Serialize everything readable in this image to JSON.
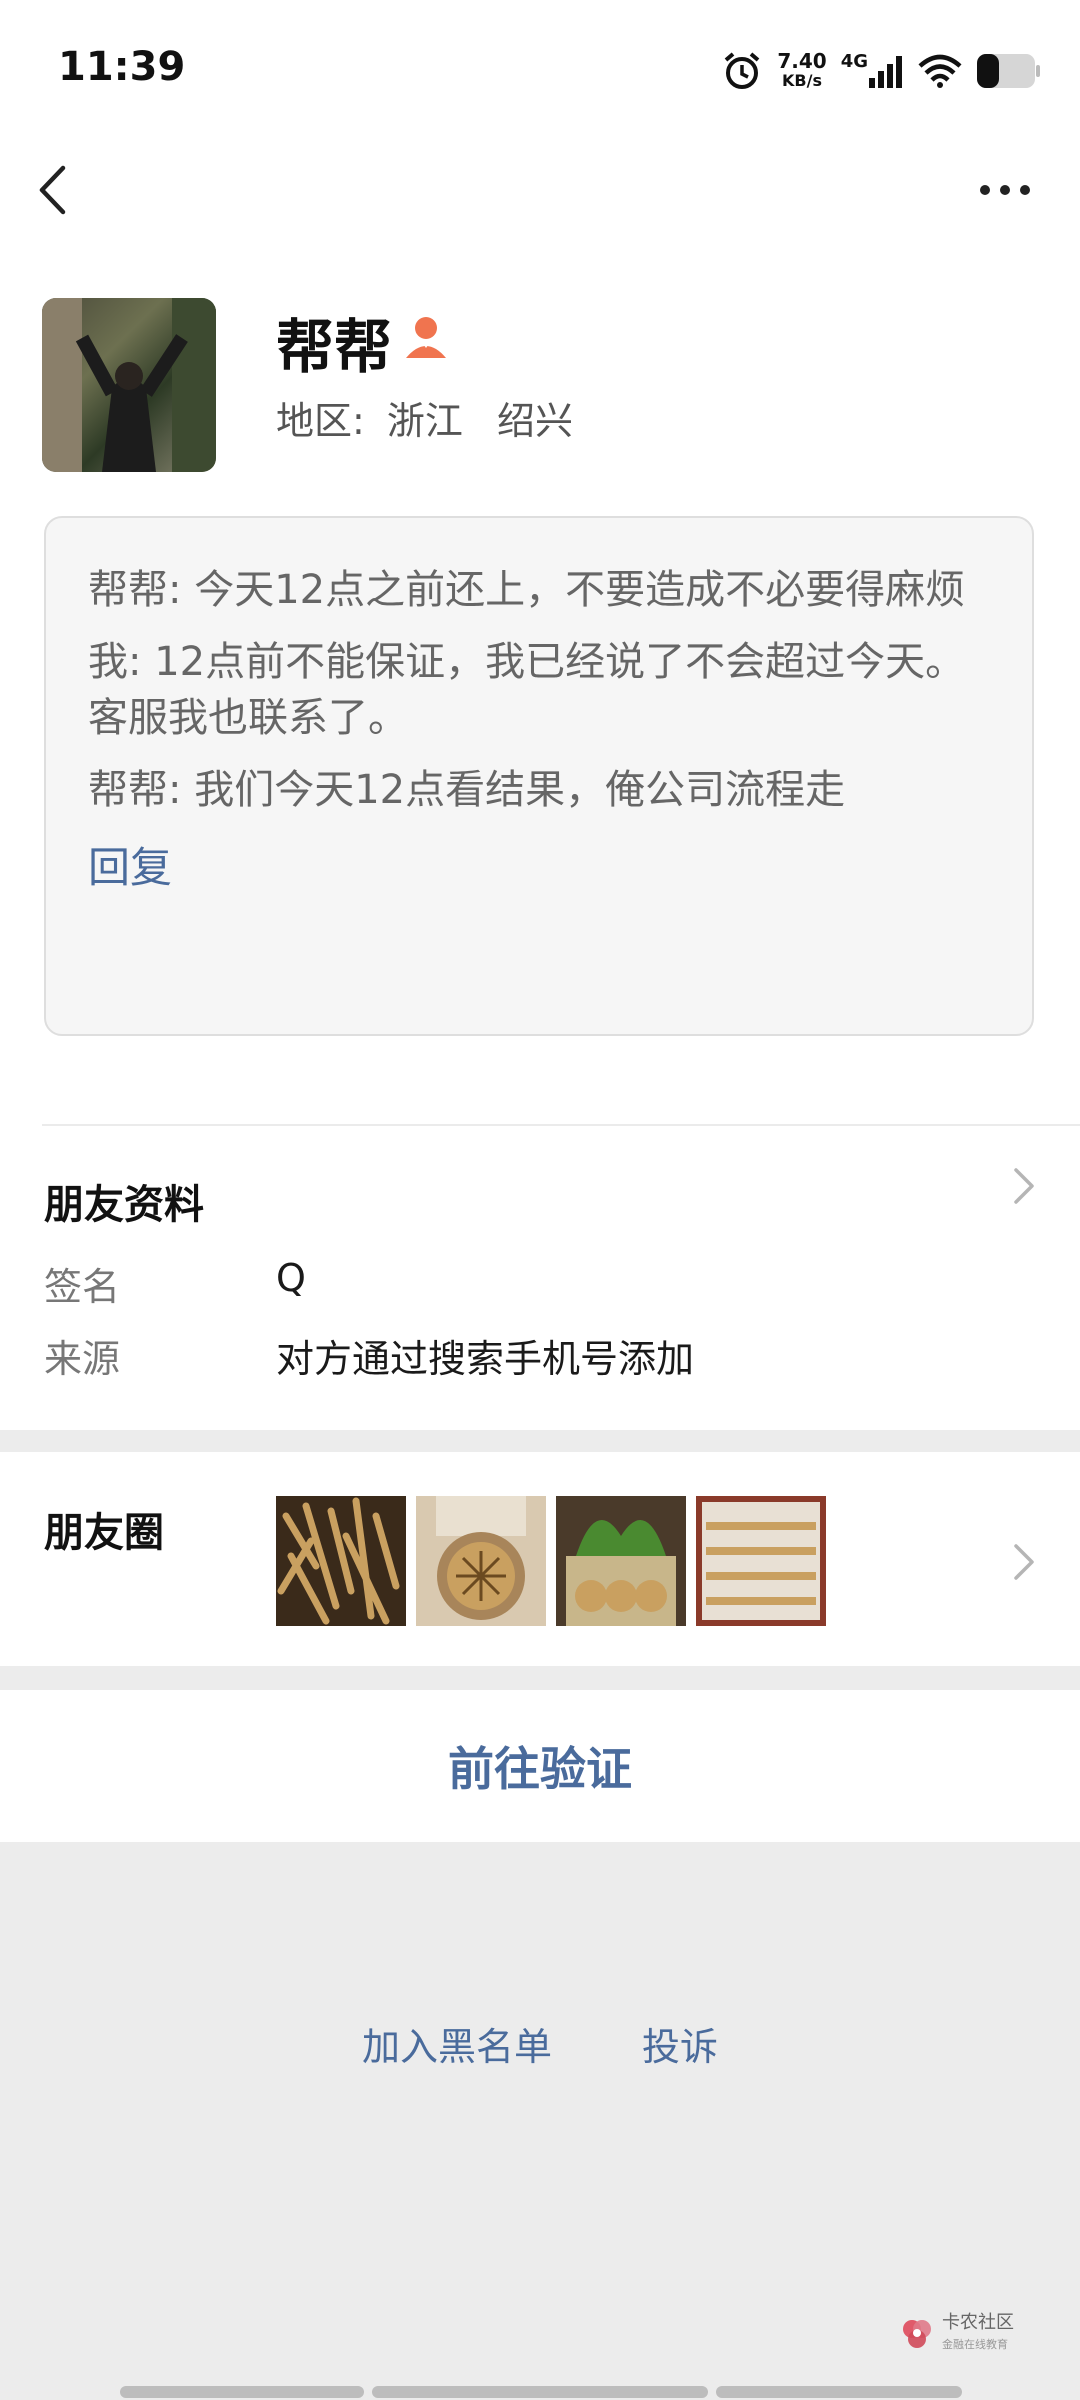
{
  "status_bar": {
    "time": "11:39",
    "speed_value": "7.40",
    "speed_unit": "KB/s",
    "network": "4G",
    "icons": [
      "alarm-icon",
      "signal-icon",
      "wifi-icon",
      "battery-icon"
    ]
  },
  "header": {
    "icons": [
      "back-icon",
      "more-icon"
    ]
  },
  "profile": {
    "name": "帮帮",
    "region_label": "地区:",
    "region_province": "浙江",
    "region_city": "绍兴"
  },
  "messages": [
    "帮帮: 今天12点之前还上，不要造成不必要得麻烦",
    "我: 12点前不能保证，我已经说了不会超过今天。客服我也联系了。",
    "帮帮: 我们今天12点看结果，俺公司流程走"
  ],
  "reply_label": "回复",
  "friend_info": {
    "title": "朋友资料",
    "signature_label": "签名",
    "signature_value": "Q",
    "source_label": "来源",
    "source_value": "对方通过搜索手机号添加"
  },
  "moments": {
    "title": "朋友圈",
    "thumbnail_count": 4
  },
  "verify_button": "前往验证",
  "bottom_actions": {
    "blacklist": "加入黑名单",
    "complain": "投诉"
  },
  "watermark": {
    "title": "卡农社区",
    "subtitle": "金融在线教育"
  },
  "colors": {
    "link": "#4a6b9c",
    "accent_person": "#f0744f",
    "page_bg": "#ececec"
  }
}
